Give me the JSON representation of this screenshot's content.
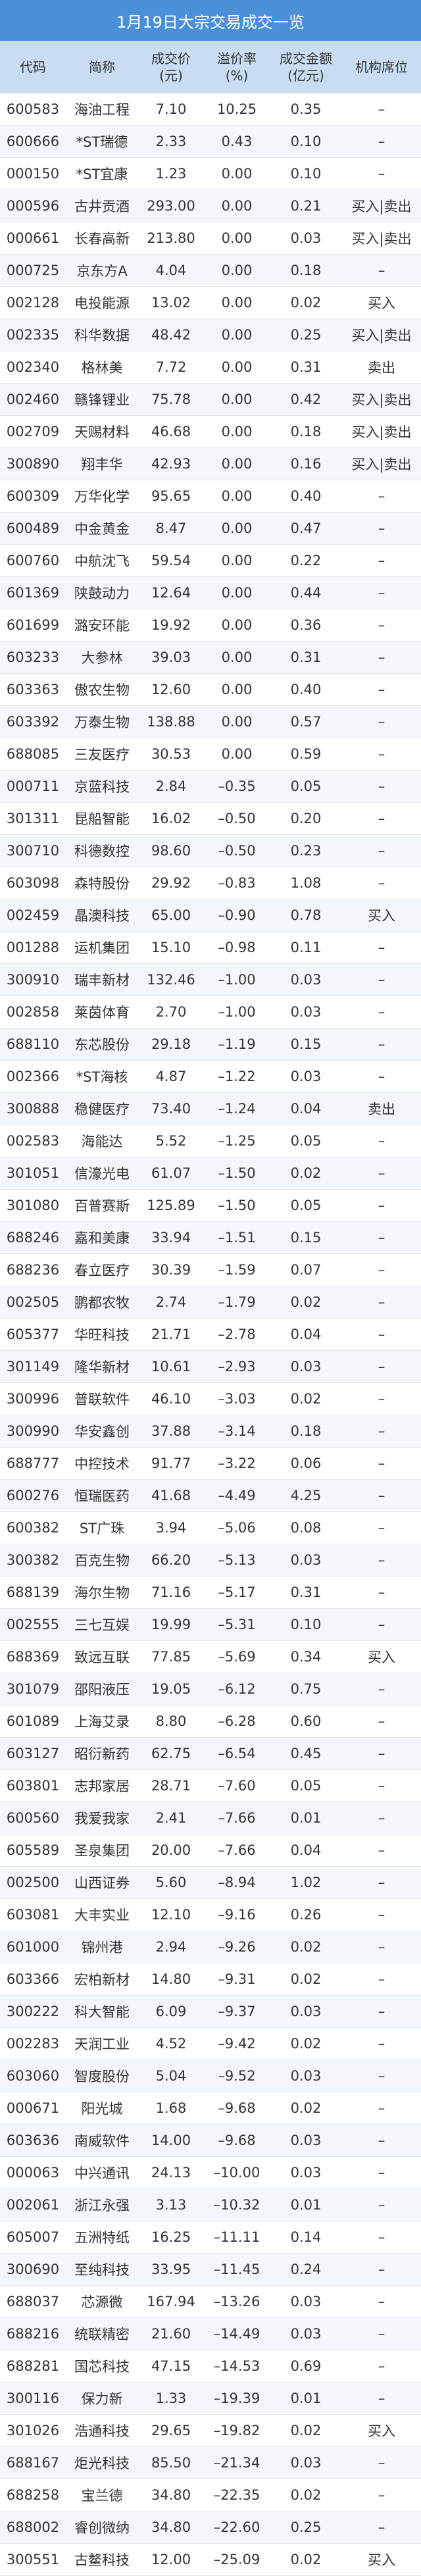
{
  "title": "1月19日大宗交易成交一览",
  "headers": {
    "code": "代码",
    "name": "简称",
    "price_1": "成交价",
    "price_2": "(元)",
    "premium_1": "溢价率",
    "premium_2": "(%)",
    "amount_1": "成交金额",
    "amount_2": "(亿元)",
    "seat": "机构席位"
  },
  "rows": [
    [
      "600583",
      "海油工程",
      "7.10",
      "10.25",
      "0.35",
      "–"
    ],
    [
      "600666",
      "*ST瑞德",
      "2.33",
      "0.43",
      "0.10",
      "–"
    ],
    [
      "000150",
      "*ST宜康",
      "1.23",
      "0.00",
      "0.10",
      "–"
    ],
    [
      "000596",
      "古井贡酒",
      "293.00",
      "0.00",
      "0.21",
      "买入|卖出"
    ],
    [
      "000661",
      "长春高新",
      "213.80",
      "0.00",
      "0.03",
      "买入|卖出"
    ],
    [
      "000725",
      "京东方A",
      "4.04",
      "0.00",
      "0.18",
      "–"
    ],
    [
      "002128",
      "电投能源",
      "13.02",
      "0.00",
      "0.02",
      "买入"
    ],
    [
      "002335",
      "科华数据",
      "48.42",
      "0.00",
      "0.25",
      "买入|卖出"
    ],
    [
      "002340",
      "格林美",
      "7.72",
      "0.00",
      "0.31",
      "卖出"
    ],
    [
      "002460",
      "赣锋锂业",
      "75.78",
      "0.00",
      "0.42",
      "买入|卖出"
    ],
    [
      "002709",
      "天赐材料",
      "46.68",
      "0.00",
      "0.18",
      "买入|卖出"
    ],
    [
      "300890",
      "翔丰华",
      "42.93",
      "0.00",
      "0.16",
      "买入|卖出"
    ],
    [
      "600309",
      "万华化学",
      "95.65",
      "0.00",
      "0.40",
      "–"
    ],
    [
      "600489",
      "中金黄金",
      "8.47",
      "0.00",
      "0.47",
      "–"
    ],
    [
      "600760",
      "中航沈飞",
      "59.54",
      "0.00",
      "0.22",
      "–"
    ],
    [
      "601369",
      "陕鼓动力",
      "12.64",
      "0.00",
      "0.44",
      "–"
    ],
    [
      "601699",
      "潞安环能",
      "19.92",
      "0.00",
      "0.36",
      "–"
    ],
    [
      "603233",
      "大参林",
      "39.03",
      "0.00",
      "0.31",
      "–"
    ],
    [
      "603363",
      "傲农生物",
      "12.60",
      "0.00",
      "0.40",
      "–"
    ],
    [
      "603392",
      "万泰生物",
      "138.88",
      "0.00",
      "0.57",
      "–"
    ],
    [
      "688085",
      "三友医疗",
      "30.53",
      "0.00",
      "0.59",
      "–"
    ],
    [
      "000711",
      "京蓝科技",
      "2.84",
      "–0.35",
      "0.05",
      "–"
    ],
    [
      "301311",
      "昆船智能",
      "16.02",
      "–0.50",
      "0.20",
      "–"
    ],
    [
      "300710",
      "科德数控",
      "98.60",
      "–0.50",
      "0.23",
      "–"
    ],
    [
      "603098",
      "森特股份",
      "29.92",
      "–0.83",
      "1.08",
      "–"
    ],
    [
      "002459",
      "晶澳科技",
      "65.00",
      "–0.90",
      "0.78",
      "买入"
    ],
    [
      "001288",
      "运机集团",
      "15.10",
      "–0.98",
      "0.11",
      "–"
    ],
    [
      "300910",
      "瑞丰新材",
      "132.46",
      "–1.00",
      "0.03",
      "–"
    ],
    [
      "002858",
      "莱茵体育",
      "2.70",
      "–1.00",
      "0.03",
      "–"
    ],
    [
      "688110",
      "东芯股份",
      "29.18",
      "–1.19",
      "0.15",
      "–"
    ],
    [
      "002366",
      "*ST海核",
      "4.87",
      "–1.22",
      "0.03",
      "–"
    ],
    [
      "300888",
      "稳健医疗",
      "73.40",
      "–1.24",
      "0.04",
      "卖出"
    ],
    [
      "002583",
      "海能达",
      "5.52",
      "–1.25",
      "0.05",
      "–"
    ],
    [
      "301051",
      "信濠光电",
      "61.07",
      "–1.50",
      "0.02",
      "–"
    ],
    [
      "301080",
      "百普赛斯",
      "125.89",
      "–1.50",
      "0.05",
      "–"
    ],
    [
      "688246",
      "嘉和美康",
      "33.94",
      "–1.51",
      "0.15",
      "–"
    ],
    [
      "688236",
      "春立医疗",
      "30.39",
      "–1.59",
      "0.07",
      "–"
    ],
    [
      "002505",
      "鹏都农牧",
      "2.74",
      "–1.79",
      "0.02",
      "–"
    ],
    [
      "605377",
      "华旺科技",
      "21.71",
      "–2.78",
      "0.04",
      "–"
    ],
    [
      "301149",
      "隆华新材",
      "10.61",
      "–2.93",
      "0.03",
      "–"
    ],
    [
      "300996",
      "普联软件",
      "46.10",
      "–3.03",
      "0.02",
      "–"
    ],
    [
      "300990",
      "华安鑫创",
      "37.88",
      "–3.14",
      "0.18",
      "–"
    ],
    [
      "688777",
      "中控技术",
      "91.77",
      "–3.22",
      "0.06",
      "–"
    ],
    [
      "600276",
      "恒瑞医药",
      "41.68",
      "–4.49",
      "4.25",
      "–"
    ],
    [
      "600382",
      "ST广珠",
      "3.94",
      "–5.06",
      "0.08",
      "–"
    ],
    [
      "300382",
      "百克生物",
      "66.20",
      "–5.13",
      "0.03",
      "–"
    ],
    [
      "688139",
      "海尔生物",
      "71.16",
      "–5.17",
      "0.31",
      "–"
    ],
    [
      "002555",
      "三七互娱",
      "19.99",
      "–5.31",
      "0.10",
      "–"
    ],
    [
      "688369",
      "致远互联",
      "77.85",
      "–5.69",
      "0.34",
      "买入"
    ],
    [
      "301079",
      "邵阳液压",
      "19.05",
      "–6.12",
      "0.75",
      "–"
    ],
    [
      "601089",
      "上海艾录",
      "8.80",
      "–6.28",
      "0.60",
      "–"
    ],
    [
      "603127",
      "昭衍新药",
      "62.75",
      "–6.54",
      "0.45",
      "–"
    ],
    [
      "603801",
      "志邦家居",
      "28.71",
      "–7.60",
      "0.05",
      "–"
    ],
    [
      "600560",
      "我爱我家",
      "2.41",
      "–7.66",
      "0.01",
      "–"
    ],
    [
      "605589",
      "圣泉集团",
      "20.00",
      "–7.66",
      "0.04",
      "–"
    ],
    [
      "002500",
      "山西证券",
      "5.60",
      "–8.94",
      "1.02",
      "–"
    ],
    [
      "603081",
      "大丰实业",
      "12.10",
      "–9.16",
      "0.26",
      "–"
    ],
    [
      "601000",
      "锦州港",
      "2.94",
      "–9.26",
      "0.02",
      "–"
    ],
    [
      "603366",
      "宏柏新材",
      "14.80",
      "–9.31",
      "0.02",
      "–"
    ],
    [
      "300222",
      "科大智能",
      "6.09",
      "–9.37",
      "0.03",
      "–"
    ],
    [
      "002283",
      "天润工业",
      "4.52",
      "–9.42",
      "0.02",
      "–"
    ],
    [
      "603060",
      "智度股份",
      "5.04",
      "–9.52",
      "0.03",
      "–"
    ],
    [
      "000671",
      "阳光城",
      "1.68",
      "–9.68",
      "0.02",
      "–"
    ],
    [
      "603636",
      "南威软件",
      "14.00",
      "–9.68",
      "0.03",
      "–"
    ],
    [
      "000063",
      "中兴通讯",
      "24.13",
      "–10.00",
      "0.03",
      "–"
    ],
    [
      "002061",
      "浙江永强",
      "3.13",
      "–10.32",
      "0.01",
      "–"
    ],
    [
      "605007",
      "五洲特纸",
      "16.25",
      "–11.11",
      "0.14",
      "–"
    ],
    [
      "300690",
      "至纯科技",
      "33.95",
      "–11.45",
      "0.24",
      "–"
    ],
    [
      "688037",
      "芯源微",
      "167.94",
      "–13.26",
      "0.03",
      "–"
    ],
    [
      "688216",
      "统联精密",
      "21.60",
      "–14.49",
      "0.03",
      "–"
    ],
    [
      "688281",
      "国芯科技",
      "47.15",
      "–14.53",
      "0.69",
      "–"
    ],
    [
      "300116",
      "保力新",
      "1.33",
      "–19.39",
      "0.01",
      "–"
    ],
    [
      "301026",
      "浩通科技",
      "29.65",
      "–19.82",
      "0.02",
      "买入"
    ],
    [
      "688167",
      "炬光科技",
      "85.50",
      "–21.34",
      "0.03",
      "–"
    ],
    [
      "688258",
      "宝兰德",
      "34.80",
      "–22.35",
      "0.02",
      "–"
    ],
    [
      "688002",
      "睿创微纳",
      "34.80",
      "–22.60",
      "0.25",
      "–"
    ],
    [
      "300551",
      "古鳌科技",
      "12.00",
      "–25.09",
      "0.02",
      "买入"
    ]
  ]
}
